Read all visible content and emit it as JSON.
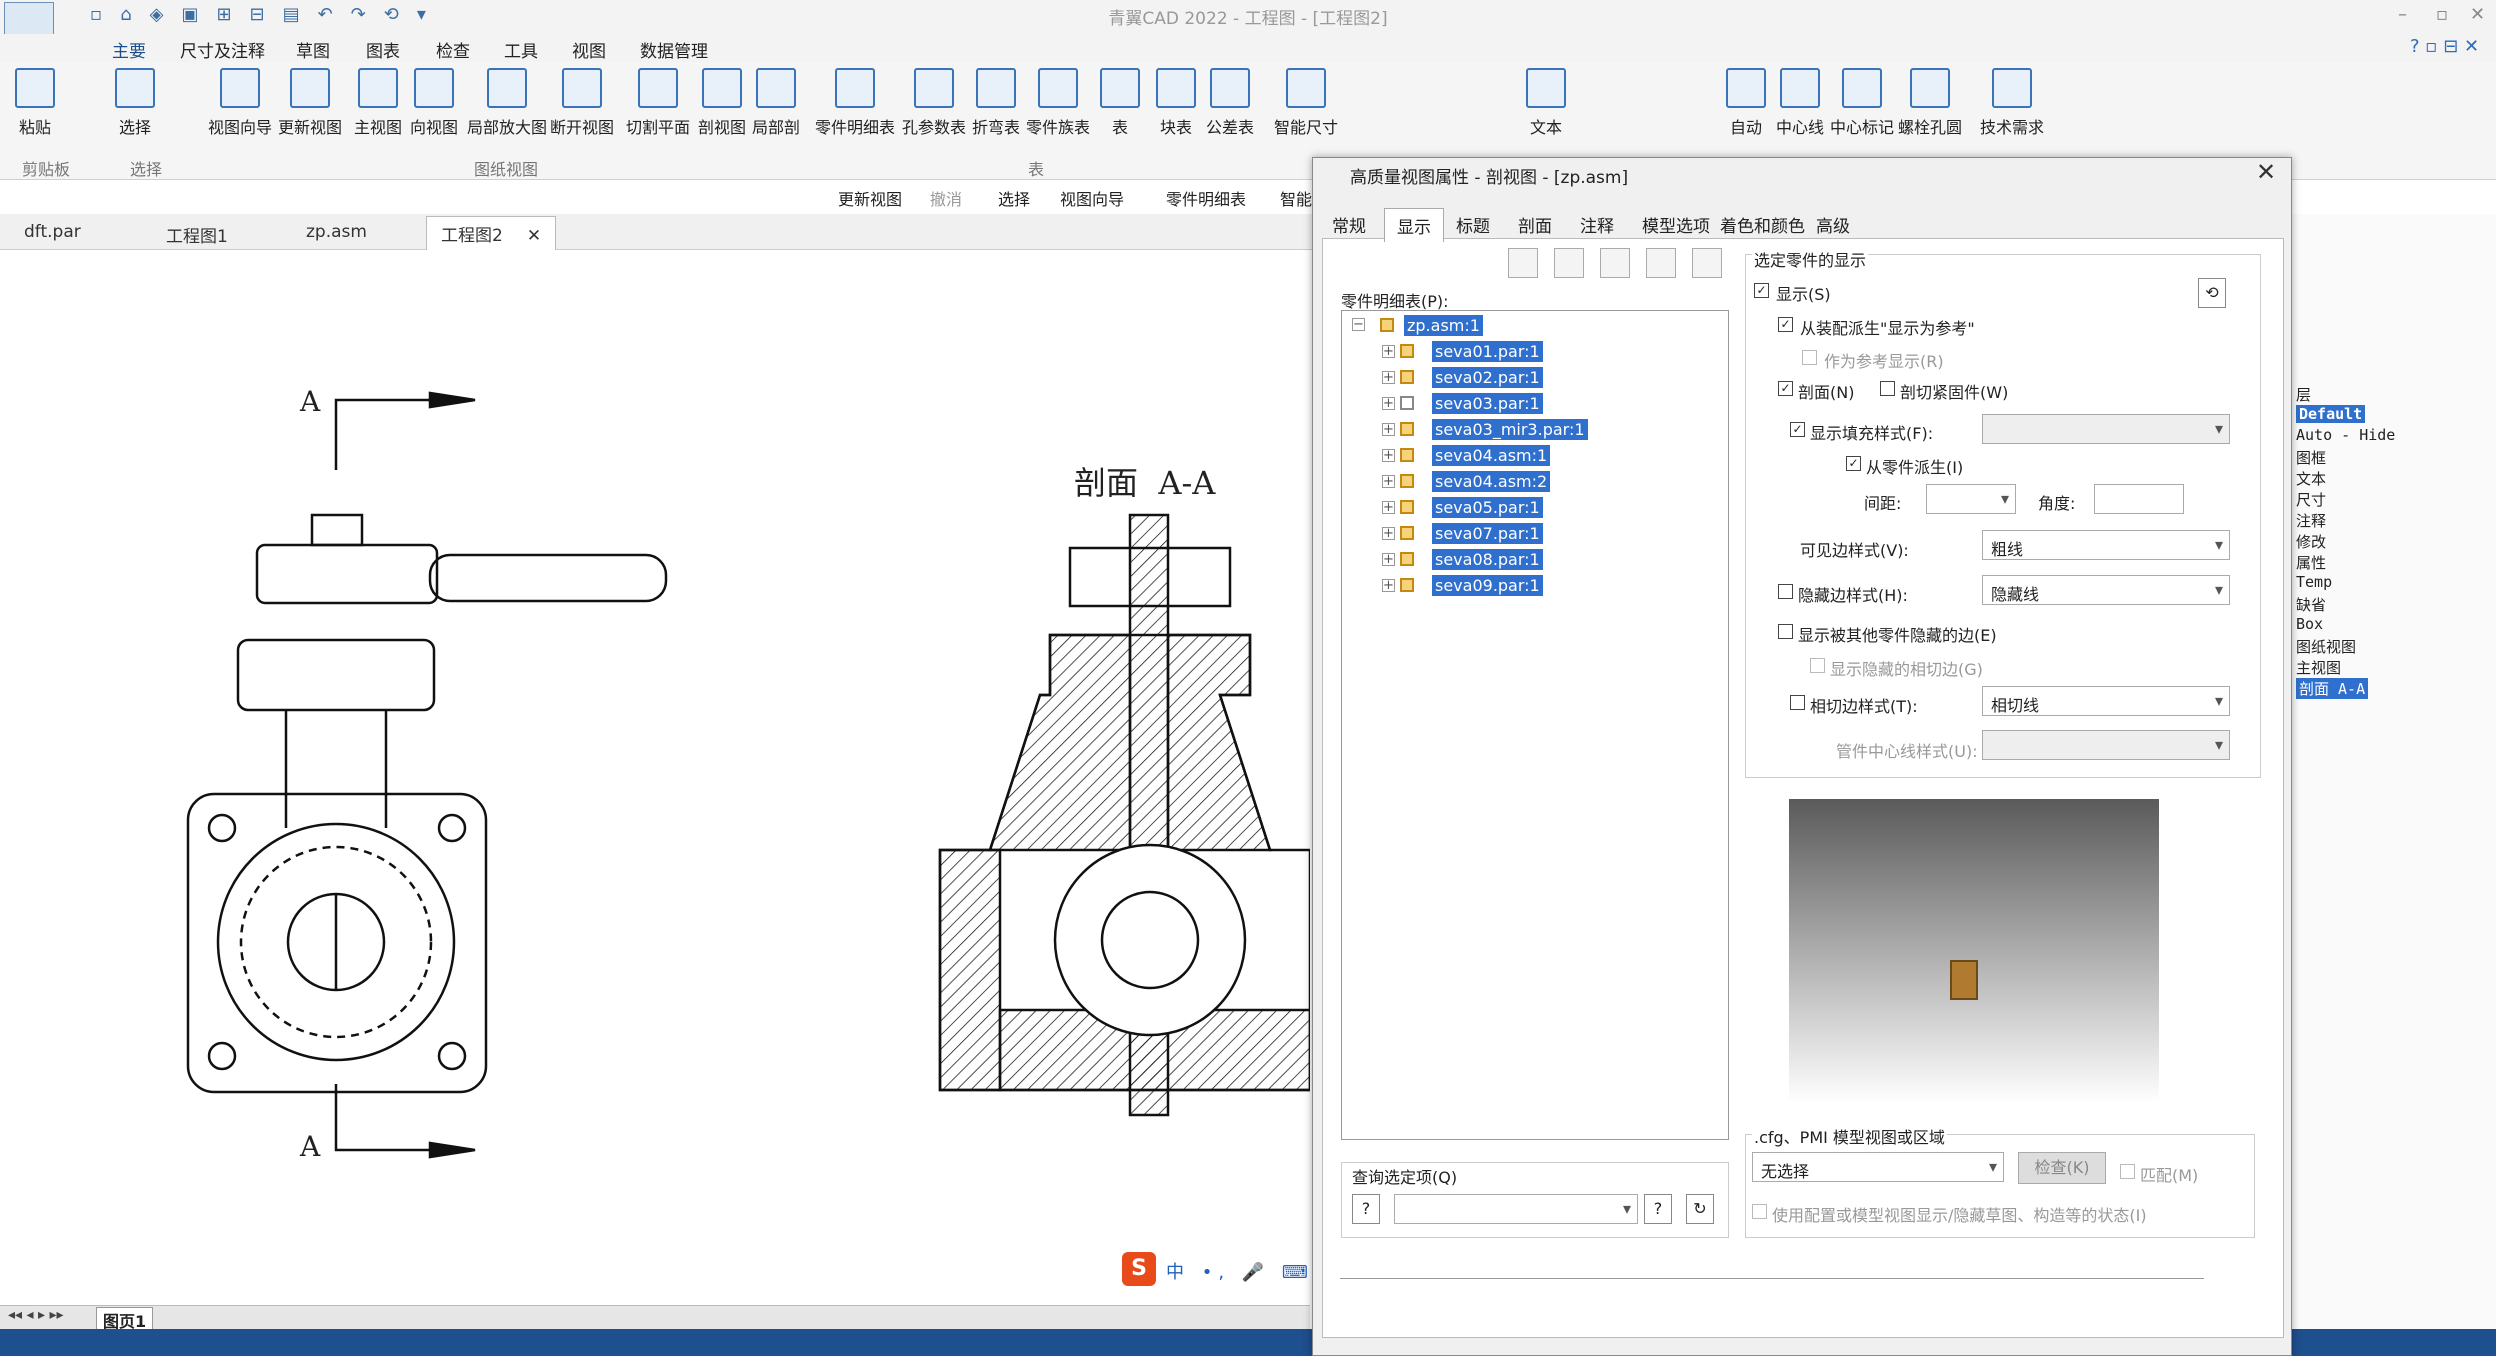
{
  "app": {
    "title": "青翼CAD 2022 - 工程图 - [工程图2]"
  },
  "menu": [
    "主要",
    "尺寸及注释",
    "草图",
    "图表",
    "检查",
    "工具",
    "视图",
    "数据管理"
  ],
  "ribbon": {
    "buttons": [
      "粘贴",
      "选择",
      "视图向导",
      "更新视图",
      "主视图",
      "向视图",
      "局部放大图",
      "断开视图",
      "切割平面",
      "剖视图",
      "局部剖",
      "零件明细表",
      "孔参数表",
      "折弯表",
      "零件族表",
      "表",
      "块表",
      "公差表",
      "智能尺寸",
      "文本",
      "自动",
      "中心线",
      "中心标记",
      "螺栓孔圆",
      "技术需求"
    ],
    "groups": [
      "剪贴板",
      "选择",
      "图纸视图",
      "表"
    ]
  },
  "toolbar2": [
    "更新视图",
    "撤消",
    "选择",
    "视图向导",
    "零件明细表",
    "智能"
  ],
  "tabs": [
    "dft.par",
    "工程图1",
    "zp.asm",
    "工程图2"
  ],
  "drawing": {
    "section_label": "剖面  A-A",
    "arrow_label_top": "A",
    "arrow_label_bottom": "A"
  },
  "status": {
    "page": "图页1"
  },
  "layers": [
    "层",
    "Default",
    "Auto - Hide",
    "图框",
    "文本",
    "尺寸",
    "注释",
    "修改",
    "属性",
    "Temp",
    "缺省",
    "Box",
    "图纸视图",
    "主视图",
    "剖面 A-A"
  ],
  "dialog": {
    "title": "高质量视图属性 - 剖视图 - [zp.asm]",
    "tabs": [
      "常规",
      "显示",
      "标题",
      "剖面",
      "注释",
      "模型选项",
      "着色和颜色",
      "高级"
    ],
    "parts_label": "零件明细表(P):",
    "tree": [
      "zp.asm:1",
      "seva01.par:1",
      "seva02.par:1",
      "seva03.par:1",
      "seva03_mir3.par:1",
      "seva04.asm:1",
      "seva04.asm:2",
      "seva05.par:1",
      "seva07.par:1",
      "seva08.par:1",
      "seva09.par:1"
    ],
    "query_label": "查询选定项(Q)",
    "section_title": "选定零件的显示",
    "show": "显示(S)",
    "from_assembly": "从装配派生\"显示为参考\"",
    "as_reference": "作为参考显示(R)",
    "section": "剖面(N)",
    "cut_fastener": "剖切紧固件(W)",
    "fill_style": "显示填充样式(F):",
    "from_part": "从零件派生(I)",
    "spacing": "间距:",
    "angle": "角度:",
    "visible_edge": "可见边样式(V):",
    "visible_edge_value": "粗线",
    "hidden_edge": "隐藏边样式(H):",
    "hidden_edge_value": "隐藏线",
    "show_hidden_by_others": "显示被其他零件隐藏的边(E)",
    "show_hidden_tangent": "显示隐藏的相切边(G)",
    "tangent_edge": "相切边样式(T):",
    "tangent_edge_value": "相切线",
    "pipe_center": "管件中心线样式(U):",
    "cfg_title": ".cfg、PMI 模型视图或区域",
    "cfg_value": "无选择",
    "check_btn": "检查(K)",
    "match": "匹配(M)",
    "use_config": "使用配置或模型视图显示/隐藏草图、构造等的状态(I)"
  },
  "ime": {
    "logo": "S",
    "text": "中 •, 🎤 ⌨ 👕 ⊞"
  }
}
